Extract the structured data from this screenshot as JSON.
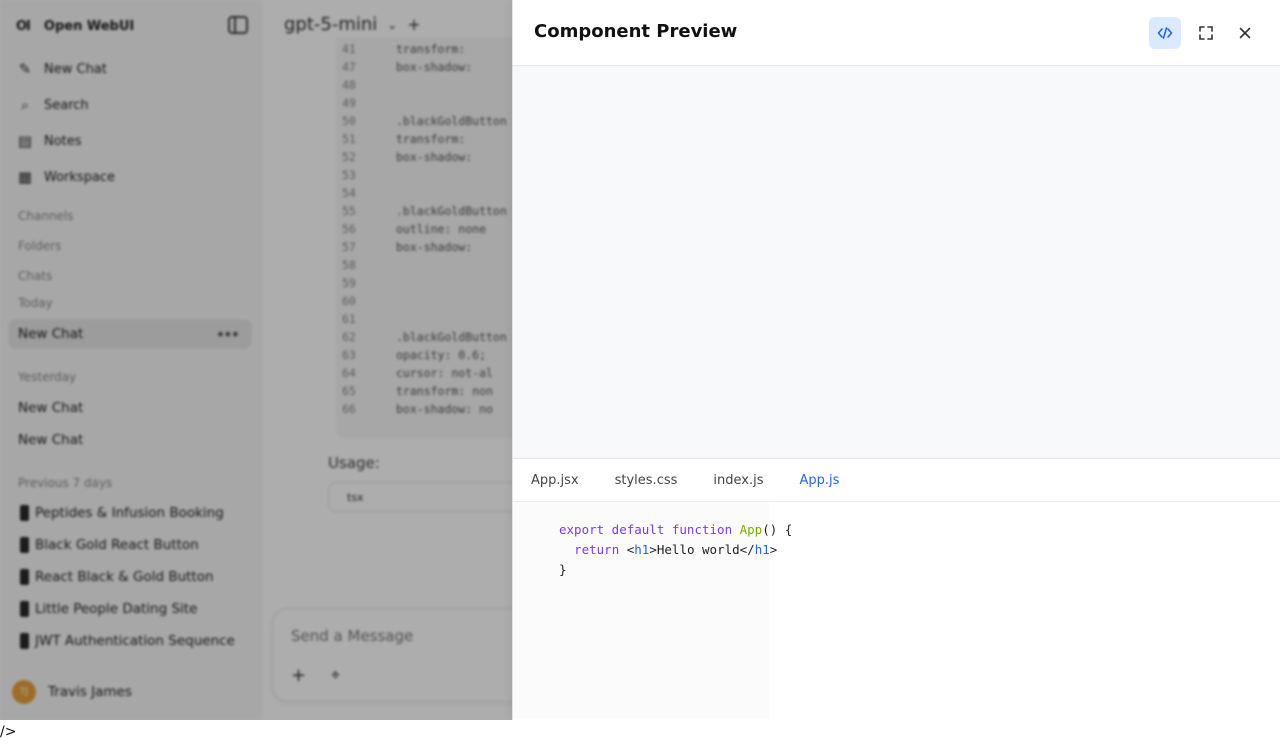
{
  "sidebar": {
    "brand": "Open WebUI",
    "nav": [
      {
        "label": "New Chat",
        "icon": "edit-icon"
      },
      {
        "label": "Search",
        "icon": "search-icon"
      },
      {
        "label": "Notes",
        "icon": "notes-icon"
      },
      {
        "label": "Workspace",
        "icon": "workspace-icon"
      }
    ],
    "sections": {
      "channels": "Channels",
      "folders": "Folders",
      "chats": "Chats",
      "today": "Today",
      "yesterday": "Yesterday",
      "previous": "Previous 7 days"
    },
    "today_chats": [
      "New Chat"
    ],
    "yesterday_chats": [
      "New Chat",
      "New Chat"
    ],
    "previous_chats": [
      "Peptides & Infusion Booking",
      "Black Gold React Button",
      "React Black & Gold Button",
      "Little People Dating Site",
      "JWT Authentication Sequence"
    ],
    "user": {
      "name": "Travis James",
      "initials": "TJ"
    }
  },
  "main": {
    "model": "gpt-5-mini",
    "line_numbers": [
      "41",
      "47",
      "48",
      "49",
      "50",
      "51",
      "52",
      "53",
      "54",
      "55",
      "56",
      "57",
      "58",
      "59",
      "60",
      "61",
      "62",
      "63",
      "64",
      "65",
      "66"
    ],
    "usage_label": "Usage:",
    "usage_code": "tsx",
    "composer_placeholder": "Send a Message"
  },
  "panel": {
    "title": "Component Preview",
    "tabs": [
      "App.jsx",
      "styles.css",
      "index.js",
      "App.js"
    ],
    "active_tab": "App.js",
    "code": {
      "l1_kw": "export default function ",
      "l1_fn": "App",
      "l1_rest": "() {",
      "l2_kw": "return ",
      "l2_a": "<",
      "l2_tag": "h1",
      "l2_b": ">Hello world</",
      "l2_tag2": "h1",
      "l2_c": ">",
      "l3": "}"
    }
  },
  "footer_text": "/>",
  "colors": {
    "accent": "#2563eb",
    "overlay": "rgba(0,0,0,0.32)"
  }
}
